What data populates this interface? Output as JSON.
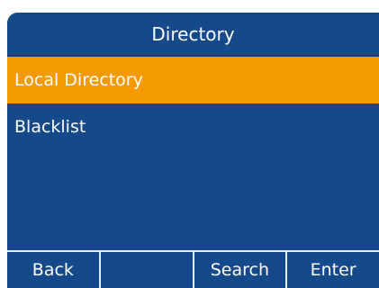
{
  "header": {
    "title": "Directory"
  },
  "menu": {
    "items": [
      {
        "label": "Local Directory",
        "selected": true
      },
      {
        "label": "Blacklist",
        "selected": false
      }
    ]
  },
  "softkeys": {
    "labels": [
      "Back",
      "",
      "Search",
      "Enter"
    ]
  },
  "colors": {
    "background": "#16498a",
    "highlight": "#f59a00",
    "separator": "#e8eef6",
    "text": "#ffffff"
  }
}
